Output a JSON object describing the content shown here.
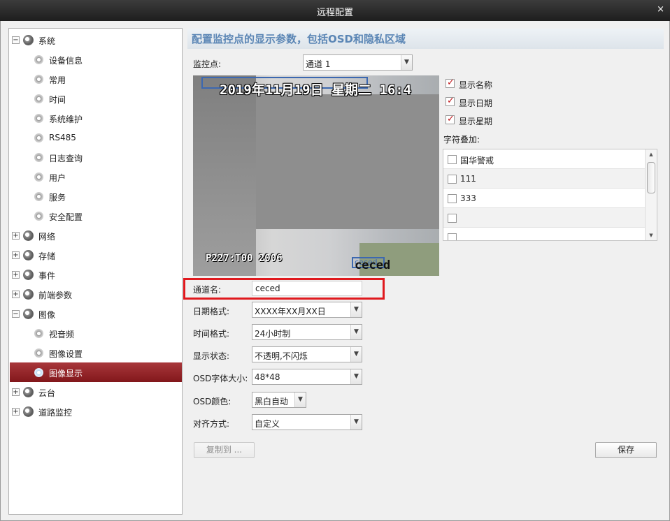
{
  "window": {
    "title": "远程配置",
    "close_glyph": "×"
  },
  "tree": {
    "nodes": [
      {
        "label": "系统",
        "expand": "−"
      },
      {
        "label": "设备信息"
      },
      {
        "label": "常用"
      },
      {
        "label": "时间"
      },
      {
        "label": "系统维护"
      },
      {
        "label": "RS485"
      },
      {
        "label": "日志查询"
      },
      {
        "label": "用户"
      },
      {
        "label": "服务"
      },
      {
        "label": "安全配置"
      },
      {
        "label": "网络",
        "expand": "+"
      },
      {
        "label": "存储",
        "expand": "+"
      },
      {
        "label": "事件",
        "expand": "+"
      },
      {
        "label": "前端参数",
        "expand": "+"
      },
      {
        "label": "图像",
        "expand": "−"
      },
      {
        "label": "视音频"
      },
      {
        "label": "图像设置"
      },
      {
        "label": "图像显示"
      },
      {
        "label": "云台",
        "expand": "+"
      },
      {
        "label": "道路监控",
        "expand": "+"
      }
    ]
  },
  "header": {
    "title": "配置监控点的显示参数，包括OSD和隐私区域"
  },
  "monitor_point": {
    "label": "监控点:",
    "value": "通道 1"
  },
  "preview": {
    "osd_date": "2019年11月19日 星期二 16:4",
    "osd_overlay": "P227:T00  2006",
    "osd_name_tag": "ceced",
    "osd_name": "ceced"
  },
  "display_options": [
    {
      "label": "显示名称",
      "checked": true
    },
    {
      "label": "显示日期",
      "checked": true
    },
    {
      "label": "显示星期",
      "checked": true
    }
  ],
  "overlay": {
    "label": "字符叠加:",
    "rows": [
      {
        "text": "国华警戒"
      },
      {
        "text": "111"
      },
      {
        "text": "333"
      },
      {
        "text": ""
      }
    ]
  },
  "channel_name": {
    "label": "通道名:",
    "value": "ceced"
  },
  "fields": {
    "date_format": {
      "label": "日期格式:",
      "value": "XXXX年XX月XX日"
    },
    "time_format": {
      "label": "时间格式:",
      "value": "24小时制"
    },
    "display_state": {
      "label": "显示状态:",
      "value": "不透明,不闪烁"
    },
    "osd_font_size": {
      "label": "OSD字体大小:",
      "value": "48*48"
    },
    "osd_color": {
      "label": "OSD颜色:",
      "value": "黑白自动"
    },
    "alignment": {
      "label": "对齐方式:",
      "value": "自定义"
    }
  },
  "buttons": {
    "copy_to": "复制到 ...",
    "save": "保存"
  },
  "icons": {
    "expand": "expand-collapse-icon",
    "group": "gear-group-icon",
    "item": "gear-icon",
    "dropdown": "chevron-down-icon",
    "checkbox": "checkbox-icon"
  },
  "colors": {
    "selected_item": "#8f1f23",
    "header_text": "#5b86b5",
    "highlight_box": "#e0191e"
  }
}
